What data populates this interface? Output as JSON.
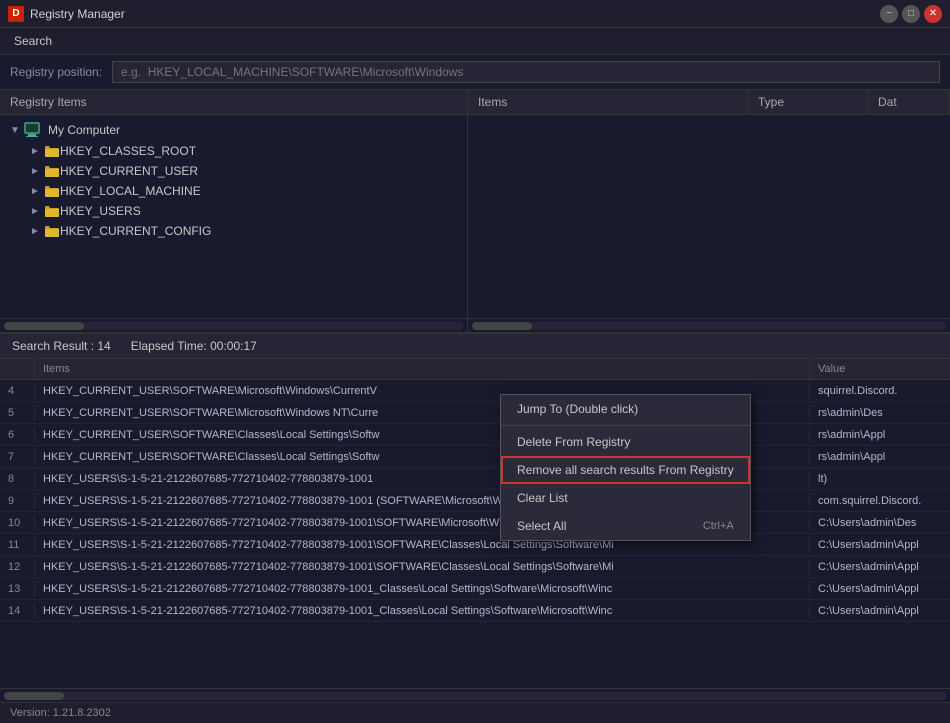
{
  "titleBar": {
    "icon": "D",
    "title": "Registry Manager"
  },
  "menuBar": {
    "items": [
      "Search"
    ]
  },
  "registryPosition": {
    "label": "Registry position:",
    "placeholder": "e.g.  HKEY_LOCAL_MACHINE\\SOFTWARE\\Microsoft\\Windows"
  },
  "leftPanel": {
    "header": "Registry Items",
    "tree": {
      "root": {
        "label": "My Computer",
        "expanded": true
      },
      "nodes": [
        "HKEY_CLASSES_ROOT",
        "HKEY_CURRENT_USER",
        "HKEY_LOCAL_MACHINE",
        "HKEY_USERS",
        "HKEY_CURRENT_CONFIG"
      ]
    }
  },
  "rightPanel": {
    "columns": [
      "Items",
      "Type",
      "Dat"
    ]
  },
  "searchResults": {
    "statsLabel": "Search Result : 14",
    "elapsedLabel": "Elapsed Time: 00:00:17",
    "columns": {
      "num": "",
      "items": "Items",
      "value": "Value"
    },
    "rows": [
      {
        "num": "4",
        "path": "HKEY_CURRENT_USER\\SOFTWARE\\Microsoft\\Windows\\CurrentV",
        "value": "squirrel.Discord."
      },
      {
        "num": "5",
        "path": "HKEY_CURRENT_USER\\SOFTWARE\\Microsoft\\Windows NT\\Curre",
        "value": "rs\\admin\\Des"
      },
      {
        "num": "6",
        "path": "HKEY_CURRENT_USER\\SOFTWARE\\Classes\\Local Settings\\Softw",
        "value": "rs\\admin\\Appl"
      },
      {
        "num": "7",
        "path": "HKEY_CURRENT_USER\\SOFTWARE\\Classes\\Local Settings\\Softw",
        "value": "rs\\admin\\Appl"
      },
      {
        "num": "8",
        "path": "HKEY_USERS\\S-1-5-21-2122607685-772710402-778803879-1001",
        "value": "lt)"
      },
      {
        "num": "9",
        "path": "HKEY_USERS\\S-1-5-21-2122607685-772710402-778803879-1001 (SOF TWARE\\Microsoft\\Windows\\CurrentVersion",
        "value": "com.squirrel.Discord."
      },
      {
        "num": "10",
        "path": "HKEY_USERS\\S-1-5-21-2122607685-772710402-778803879-1001\\SOFTWARE\\Microsoft\\Windows NT\\CurrentVers",
        "value": "C:\\Users\\admin\\Des"
      },
      {
        "num": "11",
        "path": "HKEY_USERS\\S-1-5-21-2122607685-772710402-778803879-1001\\SOFTWARE\\Classes\\Local Settings\\Software\\Mi",
        "value": "C:\\Users\\admin\\Appl"
      },
      {
        "num": "12",
        "path": "HKEY_USERS\\S-1-5-21-2122607685-772710402-778803879-1001\\SOFTWARE\\Classes\\Local Settings\\Software\\Mi",
        "value": "C:\\Users\\admin\\Appl"
      },
      {
        "num": "13",
        "path": "HKEY_USERS\\S-1-5-21-2122607685-772710402-778803879-1001_Classes\\Local Settings\\Software\\Microsoft\\Winc",
        "value": "C:\\Users\\admin\\Appl"
      },
      {
        "num": "14",
        "path": "HKEY_USERS\\S-1-5-21-2122607685-772710402-778803879-1001_Classes\\Local Settings\\Software\\Microsoft\\Winc",
        "value": "C:\\Users\\admin\\Appl"
      }
    ]
  },
  "contextMenu": {
    "items": [
      {
        "label": "Jump To   (Double click)",
        "shortcut": "",
        "highlighted": false
      },
      {
        "label": "Delete From Registry",
        "shortcut": "",
        "highlighted": false
      },
      {
        "label": "Remove all search results From Registry",
        "shortcut": "",
        "highlighted": true
      },
      {
        "label": "Clear List",
        "shortcut": "",
        "highlighted": false
      },
      {
        "label": "Select All",
        "shortcut": "Ctrl+A",
        "highlighted": false
      }
    ]
  },
  "statusBar": {
    "version": "Version: 1.21.8.2302"
  }
}
